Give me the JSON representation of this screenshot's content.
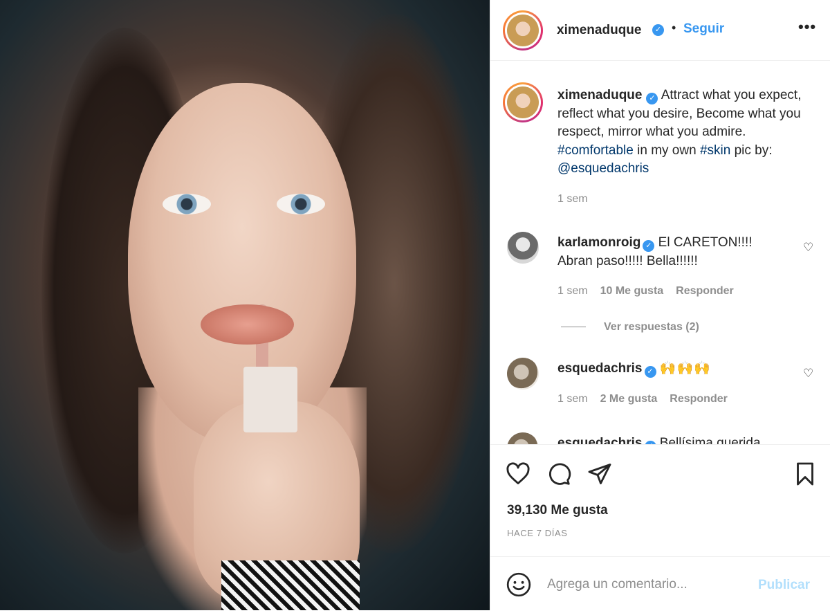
{
  "post": {
    "photo_icon": "portrait-photo"
  },
  "header": {
    "username": "ximenaduque",
    "verified_icon": "verified-badge-icon",
    "separator": "•",
    "follow_label": "Seguir",
    "more_label": "•••"
  },
  "caption": {
    "username": "ximenaduque",
    "text_1": "Attract what you expect, reflect what you desire, Become what you respect, mirror what you admire. ",
    "hashtag_1": "#comfortable",
    "text_2": " in my own ",
    "hashtag_2": "#skin",
    "text_3": " pic by: ",
    "mention": "@esquedachris",
    "time": "1 sem"
  },
  "comments": [
    {
      "username": "karlamonroig",
      "text": "El CARETON!!!! Abran paso!!!!! Bella!!!!!!",
      "time": "1 sem",
      "likes": "10 Me gusta",
      "reply_label": "Responder",
      "view_replies": "Ver respuestas (2)"
    },
    {
      "username": "esquedachris",
      "text": "🙌🙌🙌",
      "time": "1 sem",
      "likes": "2 Me gusta",
      "reply_label": "Responder"
    },
    {
      "username": "esquedachris",
      "text": "Bellísima querida"
    }
  ],
  "actions": {
    "likes_count": "39,130 Me gusta",
    "timestamp": "HACE 7 DÍAS"
  },
  "add_comment": {
    "placeholder": "Agrega un comentario...",
    "publish_label": "Publicar"
  },
  "colors": {
    "accent": "#3897f0",
    "link": "#00376b",
    "muted": "#8e8e8e",
    "publish_disabled": "#b2dffc"
  }
}
